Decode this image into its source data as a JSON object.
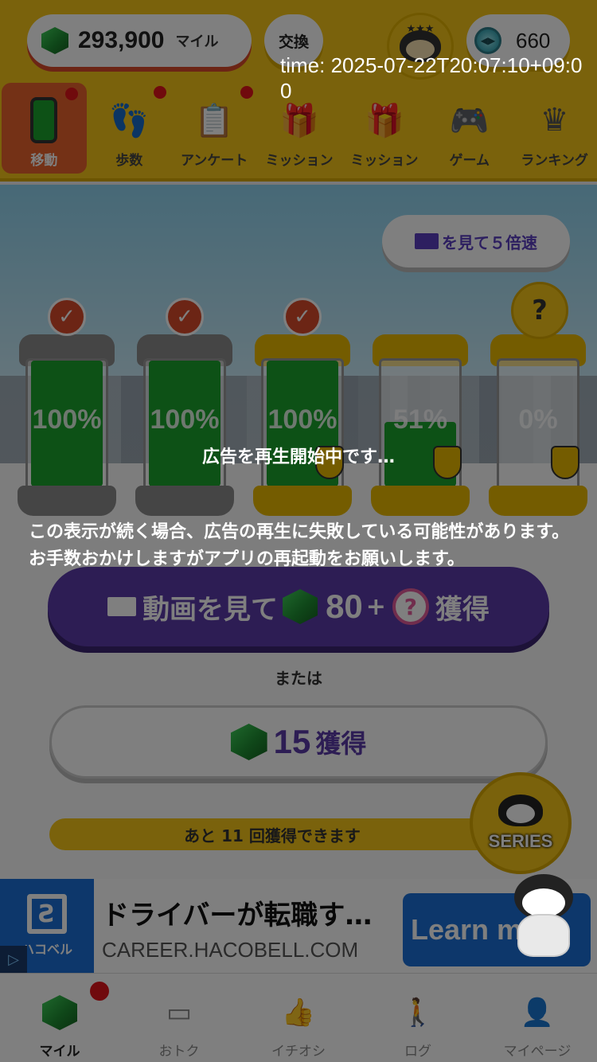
{
  "header": {
    "miles_value": "293,900",
    "miles_unit": "マイル",
    "exchange_label": "交換",
    "coin_value": "660",
    "stars": "★★★"
  },
  "time_overlay": "time: 2025-07-22T20:07:10+09:00",
  "tabs": [
    {
      "label": "移動",
      "icon": "battery-icon",
      "active": true,
      "dot": true
    },
    {
      "label": "歩数",
      "icon": "footprints-icon",
      "active": false,
      "dot": true
    },
    {
      "label": "アンケート",
      "icon": "clipboard-icon",
      "active": false,
      "dot": true
    },
    {
      "label": "ミッション",
      "icon": "gift-a-icon",
      "active": false,
      "dot": false
    },
    {
      "label": "ミッション",
      "icon": "gift-b-icon",
      "active": false,
      "dot": false
    },
    {
      "label": "ゲーム",
      "icon": "gamepad-icon",
      "active": false,
      "dot": false
    },
    {
      "label": "ランキング",
      "icon": "crown-icon",
      "active": false,
      "dot": false
    }
  ],
  "speed_button": {
    "label": "を見て５倍速"
  },
  "bottles": [
    {
      "percent": "100%",
      "fill": 1.0,
      "status": "done",
      "color": "#8a8a8a"
    },
    {
      "percent": "100%",
      "fill": 1.0,
      "status": "done",
      "color": "#8a8a8a"
    },
    {
      "percent": "100%",
      "fill": 1.0,
      "status": "done",
      "color": "#e8b800"
    },
    {
      "percent": "51%",
      "fill": 0.51,
      "status": "filling",
      "color": "#e8b800"
    },
    {
      "percent": "0%",
      "fill": 0.0,
      "status": "unknown",
      "color": "#e8b800"
    }
  ],
  "video_button": {
    "prefix": "動画を見て",
    "amount": "80",
    "plus": "+",
    "mystery": "?",
    "suffix": "獲得"
  },
  "or_text": "または",
  "earn_button": {
    "amount": "15",
    "label": "獲得"
  },
  "remaining_text": "あと 11 回獲得できます",
  "series_badge": {
    "label": "SERIES"
  },
  "ad": {
    "logo_text": "ハコベル",
    "title": "ドライバーが転職す…",
    "domain": "CAREER.HACOBELL.COM",
    "cta": "Learn more"
  },
  "bottom_nav": [
    {
      "label": "マイル",
      "icon": "gem-icon",
      "active": true,
      "dot": true
    },
    {
      "label": "おトク",
      "icon": "coupon-icon",
      "active": false,
      "dot": false
    },
    {
      "label": "イチオシ",
      "icon": "thumbs-up-icon",
      "active": false,
      "dot": false
    },
    {
      "label": "ログ",
      "icon": "walking-icon",
      "active": false,
      "dot": false
    },
    {
      "label": "マイページ",
      "icon": "person-icon",
      "active": false,
      "dot": false
    }
  ],
  "overlay": {
    "loading": "広告を再生開始中です…",
    "notice": "この表示が続く場合、広告の再生に失敗している可能性があります。お手数おかけしますがアプリの再起動をお願いします。"
  }
}
